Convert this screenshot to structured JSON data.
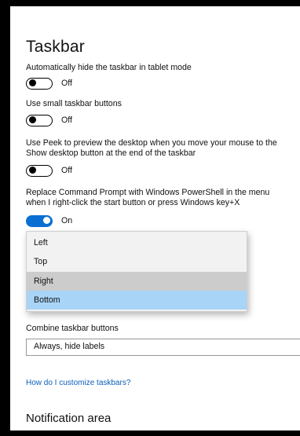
{
  "page": {
    "title": "Taskbar"
  },
  "settings": [
    {
      "label": "Automatically hide the taskbar in tablet mode",
      "state": "Off"
    },
    {
      "label": "Use small taskbar buttons",
      "state": "Off"
    },
    {
      "label": "Use Peek to preview the desktop when you move your mouse to the Show desktop button at the end of the taskbar",
      "line1": "Use Peek to preview the desktop when you move your mouse to the",
      "line2": "Show desktop button at the end of the taskbar",
      "state": "Off"
    },
    {
      "label": "Replace Command Prompt with Windows PowerShell in the menu when I right-click the start button or press Windows key+X",
      "line1": "Replace Command Prompt with Windows PowerShell in the menu",
      "line2": "when I right-click the start button or press Windows key+X",
      "state": "On"
    }
  ],
  "location_dropdown": {
    "options": [
      "Left",
      "Top",
      "Right",
      "Bottom"
    ],
    "hovered": "Right",
    "selected": "Bottom"
  },
  "combine": {
    "label": "Combine taskbar buttons",
    "value": "Always, hide labels"
  },
  "help_link": "How do I customize taskbars?",
  "notification_area": "Notification area",
  "colors": {
    "accent": "#0a6fd1",
    "selected_bg": "#a8d4f7",
    "hover_bg": "#cccccc",
    "link": "#0a5fb8"
  }
}
